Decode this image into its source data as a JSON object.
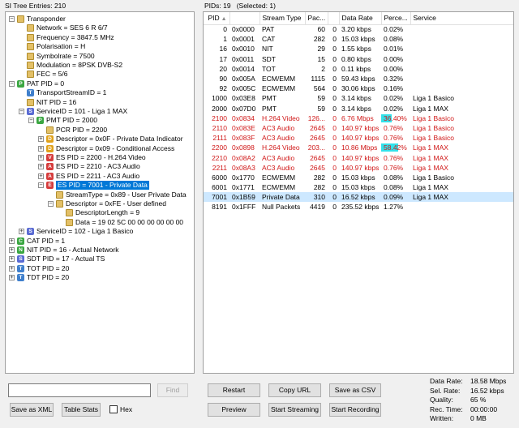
{
  "left_header": "SI Tree Entries: 210",
  "right_header": {
    "pids": "PIDs: 19",
    "selected": "(Selected: 1)"
  },
  "tree": [
    {
      "text": "Transponder",
      "icon": "folder",
      "exp": "-",
      "level": 0
    },
    {
      "text": "Network = SES 6 R 6/7",
      "icon": "folder",
      "exp": "",
      "level": 1
    },
    {
      "text": "Frequency = 3847.5 MHz",
      "icon": "folder",
      "exp": "",
      "level": 1
    },
    {
      "text": "Polarisation = H",
      "icon": "folder",
      "exp": "",
      "level": 1
    },
    {
      "text": "Symbolrate = 7500",
      "icon": "folder",
      "exp": "",
      "level": 1
    },
    {
      "text": "Modulation = 8PSK DVB-S2",
      "icon": "folder",
      "exp": "",
      "level": 1
    },
    {
      "text": "FEC = 5/6",
      "icon": "folder",
      "exp": "",
      "level": 1
    },
    {
      "text": "PAT PID = 0",
      "icon": "P",
      "exp": "-",
      "level": 0
    },
    {
      "text": "TransportStreamID = 1",
      "icon": "T",
      "exp": "",
      "level": 1
    },
    {
      "text": "NIT PID = 16",
      "icon": "folder",
      "exp": "",
      "level": 1
    },
    {
      "text": "ServiceID = 101 - Liga 1 MAX",
      "icon": "S",
      "exp": "-",
      "level": 1
    },
    {
      "text": "PMT PID = 2000",
      "icon": "P",
      "exp": "-",
      "level": 2
    },
    {
      "text": "PCR PID = 2200",
      "icon": "folder",
      "exp": "",
      "level": 3
    },
    {
      "text": "Descriptor = 0x0F - Private Data Indicator",
      "icon": "D",
      "exp": "+",
      "level": 3
    },
    {
      "text": "Descriptor = 0x09 - Conditional Access",
      "icon": "D",
      "exp": "+",
      "level": 3
    },
    {
      "text": "ES PID = 2200 - H.264 Video",
      "icon": "V",
      "exp": "+",
      "level": 3
    },
    {
      "text": "ES PID = 2210 - AC3 Audio",
      "icon": "A",
      "exp": "+",
      "level": 3
    },
    {
      "text": "ES PID = 2211 - AC3 Audio",
      "icon": "A",
      "exp": "+",
      "level": 3
    },
    {
      "text": "ES PID = 7001 - Private Data",
      "icon": "E",
      "exp": "-",
      "level": 3,
      "selected": true
    },
    {
      "text": "StreamType = 0x89 - User Private Data",
      "icon": "folder",
      "exp": "",
      "level": 4
    },
    {
      "text": "Descriptor = 0xFE - User defined",
      "icon": "folder",
      "exp": "-",
      "level": 4
    },
    {
      "text": "DescriptorLength = 9",
      "icon": "folder",
      "exp": "",
      "level": 5
    },
    {
      "text": "Data = 19 02 5C 00 00 00 00 00 00",
      "icon": "folder",
      "exp": "",
      "level": 5
    },
    {
      "text": "ServiceID = 102 - Liga 1 Basico",
      "icon": "S",
      "exp": "+",
      "level": 1
    },
    {
      "text": "CAT PID = 1",
      "icon": "C",
      "exp": "+",
      "level": 0
    },
    {
      "text": "NIT PID = 16 - Actual Network",
      "icon": "N",
      "exp": "+",
      "level": 0
    },
    {
      "text": "SDT PID = 17 - Actual TS",
      "icon": "S",
      "exp": "+",
      "level": 0
    },
    {
      "text": "TOT PID = 20",
      "icon": "T",
      "exp": "+",
      "level": 0
    },
    {
      "text": "TDT PID = 20",
      "icon": "T",
      "exp": "+",
      "level": 0
    }
  ],
  "columns": [
    "PID",
    "",
    "Stream Type",
    "Pac...",
    "",
    "Data Rate",
    "Perce...",
    "Service"
  ],
  "rows": [
    {
      "pid": "0",
      "hex": "0x0000",
      "type": "PAT",
      "pac": "60",
      "cc": "0",
      "rate": "3.20 kbps",
      "perc": "0.02%",
      "pct": 0.02,
      "service": "",
      "red": false
    },
    {
      "pid": "1",
      "hex": "0x0001",
      "type": "CAT",
      "pac": "282",
      "cc": "0",
      "rate": "15.03 kbps",
      "perc": "0.08%",
      "pct": 0.08,
      "service": "",
      "red": false
    },
    {
      "pid": "16",
      "hex": "0x0010",
      "type": "NIT",
      "pac": "29",
      "cc": "0",
      "rate": "1.55 kbps",
      "perc": "0.01%",
      "pct": 0.01,
      "service": "",
      "red": false
    },
    {
      "pid": "17",
      "hex": "0x0011",
      "type": "SDT",
      "pac": "15",
      "cc": "0",
      "rate": "0.80 kbps",
      "perc": "0.00%",
      "pct": 0,
      "service": "",
      "red": false
    },
    {
      "pid": "20",
      "hex": "0x0014",
      "type": "TOT",
      "pac": "2",
      "cc": "0",
      "rate": "0.11 kbps",
      "perc": "0.00%",
      "pct": 0,
      "service": "",
      "red": false
    },
    {
      "pid": "90",
      "hex": "0x005A",
      "type": "ECM/EMM",
      "pac": "1115",
      "cc": "0",
      "rate": "59.43 kbps",
      "perc": "0.32%",
      "pct": 0.32,
      "service": "",
      "red": false
    },
    {
      "pid": "92",
      "hex": "0x005C",
      "type": "ECM/EMM",
      "pac": "564",
      "cc": "0",
      "rate": "30.06 kbps",
      "perc": "0.16%",
      "pct": 0.16,
      "service": "",
      "red": false
    },
    {
      "pid": "1000",
      "hex": "0x03E8",
      "type": "PMT",
      "pac": "59",
      "cc": "0",
      "rate": "3.14 kbps",
      "perc": "0.02%",
      "pct": 0.02,
      "service": "Liga 1 Basico",
      "red": false
    },
    {
      "pid": "2000",
      "hex": "0x07D0",
      "type": "PMT",
      "pac": "59",
      "cc": "0",
      "rate": "3.14 kbps",
      "perc": "0.02%",
      "pct": 0.02,
      "service": "Liga 1 MAX",
      "red": false
    },
    {
      "pid": "2100",
      "hex": "0x0834",
      "type": "H.264 Video",
      "pac": "126...",
      "cc": "0",
      "rate": "6.76 Mbps",
      "perc": "36.40%",
      "pct": 36.4,
      "service": "Liga 1 Basico",
      "red": true
    },
    {
      "pid": "2110",
      "hex": "0x083E",
      "type": "AC3 Audio",
      "pac": "2645",
      "cc": "0",
      "rate": "140.97 kbps",
      "perc": "0.76%",
      "pct": 0.76,
      "service": "Liga 1 Basico",
      "red": true
    },
    {
      "pid": "2111",
      "hex": "0x083F",
      "type": "AC3 Audio",
      "pac": "2645",
      "cc": "0",
      "rate": "140.97 kbps",
      "perc": "0.76%",
      "pct": 0.76,
      "service": "Liga 1 Basico",
      "red": true
    },
    {
      "pid": "2200",
      "hex": "0x0898",
      "type": "H.264 Video",
      "pac": "203...",
      "cc": "0",
      "rate": "10.86 Mbps",
      "perc": "58.42%",
      "pct": 58.42,
      "service": "Liga 1 MAX",
      "red": true
    },
    {
      "pid": "2210",
      "hex": "0x08A2",
      "type": "AC3 Audio",
      "pac": "2645",
      "cc": "0",
      "rate": "140.97 kbps",
      "perc": "0.76%",
      "pct": 0.76,
      "service": "Liga 1 MAX",
      "red": true
    },
    {
      "pid": "2211",
      "hex": "0x08A3",
      "type": "AC3 Audio",
      "pac": "2645",
      "cc": "0",
      "rate": "140.97 kbps",
      "perc": "0.76%",
      "pct": 0.76,
      "service": "Liga 1 MAX",
      "red": true
    },
    {
      "pid": "6000",
      "hex": "0x1770",
      "type": "ECM/EMM",
      "pac": "282",
      "cc": "0",
      "rate": "15.03 kbps",
      "perc": "0.08%",
      "pct": 0.08,
      "service": "Liga 1 Basico",
      "red": false
    },
    {
      "pid": "6001",
      "hex": "0x1771",
      "type": "ECM/EMM",
      "pac": "282",
      "cc": "0",
      "rate": "15.03 kbps",
      "perc": "0.08%",
      "pct": 0.08,
      "service": "Liga 1 MAX",
      "red": false
    },
    {
      "pid": "7001",
      "hex": "0x1B59",
      "type": "Private Data",
      "pac": "310",
      "cc": "0",
      "rate": "16.52 kbps",
      "perc": "0.09%",
      "pct": 0.09,
      "service": "Liga 1 MAX",
      "red": false,
      "selected": true
    },
    {
      "pid": "8191",
      "hex": "0x1FFF",
      "type": "Null Packets",
      "pac": "4419",
      "cc": "0",
      "rate": "235.52 kbps",
      "perc": "1.27%",
      "pct": 1.27,
      "service": "",
      "red": false
    }
  ],
  "search": {
    "value": "",
    "find_label": "Find"
  },
  "left_buttons": {
    "save_xml": "Save as XML",
    "table_stats": "Table Stats",
    "hex": "Hex"
  },
  "right_buttons": {
    "restart": "Restart",
    "copy_url": "Copy URL",
    "save_csv": "Save as CSV",
    "preview": "Preview",
    "start_streaming": "Start Streaming",
    "start_recording": "Start Recording"
  },
  "stats": [
    {
      "label": "Data Rate:",
      "value": "18.58 Mbps"
    },
    {
      "label": "Sel. Rate:",
      "value": "16.52 kbps"
    },
    {
      "label": "Quality:",
      "value": "65 %"
    },
    {
      "label": "Rec. Time:",
      "value": "00:00:00"
    },
    {
      "label": "Written:",
      "value": "0 MB"
    }
  ],
  "colors": {
    "selection": "#0078d7",
    "perc_bar": "#33e1ea",
    "error_red": "#d01818",
    "selected_row": "#cde8ff"
  }
}
